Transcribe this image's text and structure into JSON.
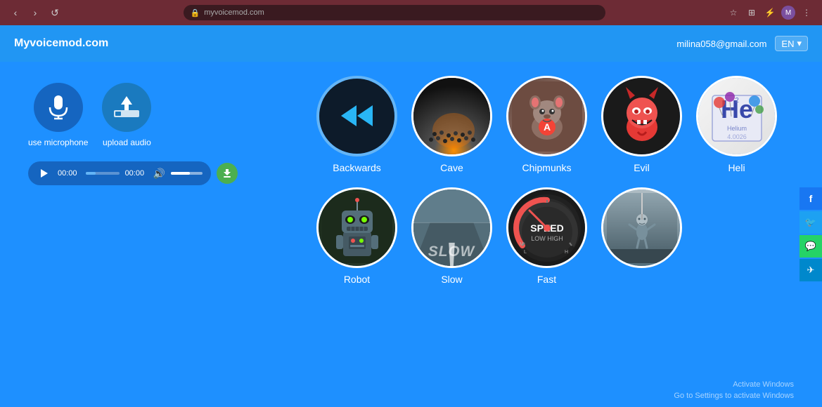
{
  "browser": {
    "url": "myvoicemod.com",
    "nav": {
      "back": "‹",
      "forward": "›",
      "reload": "↺",
      "lock": "🔒"
    },
    "star_icon": "☆",
    "ext_icon1": "⊞",
    "ext_icon2": "⚡",
    "profile_initial": "M"
  },
  "header": {
    "logo": "Myvoicemod.com",
    "email": "milina058@gmail.com",
    "lang": "EN",
    "lang_arrow": "▾"
  },
  "player": {
    "play_icon": "▶",
    "time_start": "00:00",
    "time_end": "00:00",
    "volume_icon": "🔊",
    "download_icon": "⬇"
  },
  "controls": {
    "microphone_label": "use microphone",
    "upload_label": "upload audio",
    "mic_icon": "🎤",
    "upload_icon": "⬆"
  },
  "effects": [
    {
      "id": "backwards",
      "label": "Backwards",
      "selected": true
    },
    {
      "id": "cave",
      "label": "Cave",
      "selected": false
    },
    {
      "id": "chipmunks",
      "label": "Chipmunks",
      "selected": false
    },
    {
      "id": "evil",
      "label": "Evil",
      "selected": false
    },
    {
      "id": "heli",
      "label": "Heli",
      "selected": false
    },
    {
      "id": "robot",
      "label": "Robot",
      "selected": false
    },
    {
      "id": "slow",
      "label": "Slow",
      "selected": false
    },
    {
      "id": "fast",
      "label": "Fast",
      "selected": false
    },
    {
      "id": "last",
      "label": "",
      "selected": false
    }
  ],
  "social": [
    {
      "id": "facebook",
      "icon": "f",
      "class": "fb"
    },
    {
      "id": "twitter",
      "icon": "t",
      "class": "tw"
    },
    {
      "id": "whatsapp",
      "icon": "w",
      "class": "wa"
    },
    {
      "id": "telegram",
      "icon": "✈",
      "class": "tg"
    }
  ],
  "windows_watermark": {
    "line1": "Activate Windows",
    "line2": "Go to Settings to activate Windows"
  }
}
